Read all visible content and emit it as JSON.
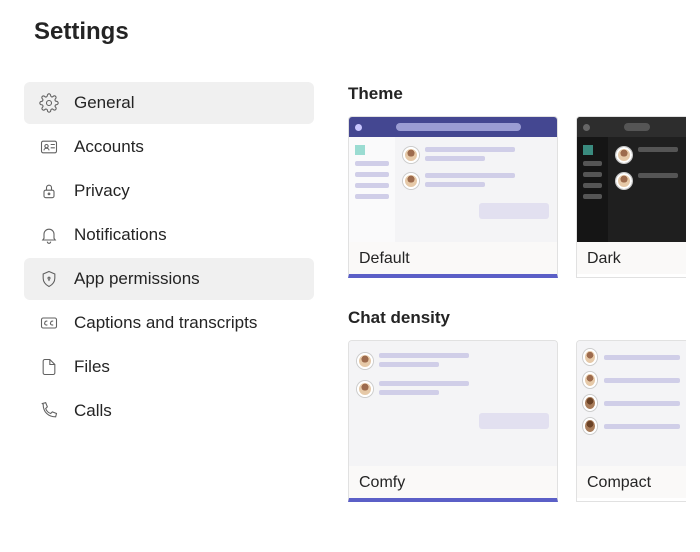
{
  "title": "Settings",
  "sidebar": {
    "items": [
      {
        "label": "General"
      },
      {
        "label": "Accounts"
      },
      {
        "label": "Privacy"
      },
      {
        "label": "Notifications"
      },
      {
        "label": "App permissions"
      },
      {
        "label": "Captions and transcripts"
      },
      {
        "label": "Files"
      },
      {
        "label": "Calls"
      }
    ]
  },
  "sections": {
    "theme": {
      "title": "Theme",
      "options": [
        {
          "label": "Default"
        },
        {
          "label": "Dark"
        }
      ]
    },
    "chat_density": {
      "title": "Chat density",
      "options": [
        {
          "label": "Comfy"
        },
        {
          "label": "Compact"
        }
      ]
    }
  }
}
